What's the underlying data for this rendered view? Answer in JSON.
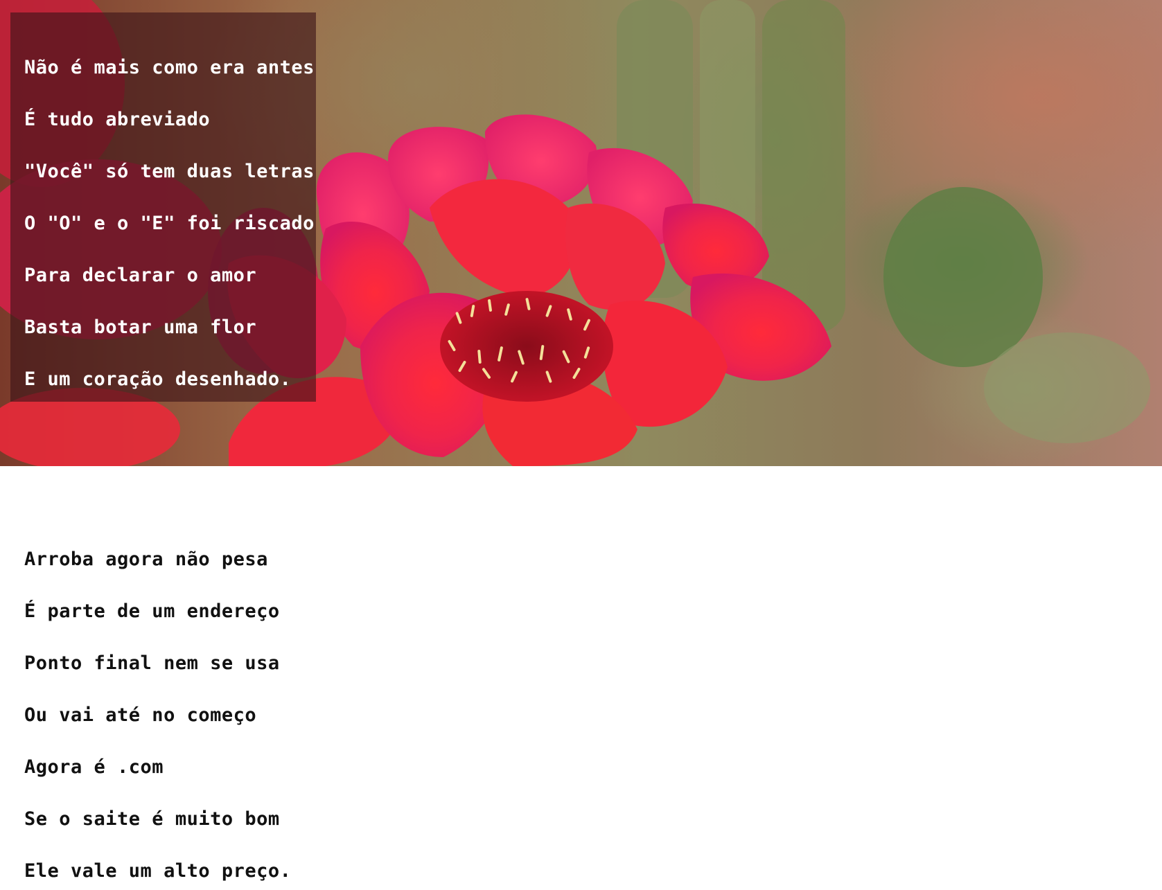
{
  "hero": {
    "image": "red-cactus-flower-photo",
    "caption_lines": [
      "Não é mais como era antes",
      "É tudo abreviado",
      "\"Você\" só tem duas letras",
      "O \"O\" e o \"E\" foi riscado",
      "Para declarar o amor",
      "Basta botar uma flor",
      "E um coração desenhado."
    ]
  },
  "poem": {
    "lines": [
      "Arroba agora não pesa",
      "É parte de um endereço",
      "Ponto final nem se usa",
      "Ou vai até no começo",
      "Agora é .com",
      "Se o saite é muito bom",
      "Ele vale um alto preço."
    ]
  },
  "colors": {
    "caption_text": "#ffffff",
    "caption_overlay": "#3c1419",
    "poem_text": "#111111",
    "flower": "#e8203f",
    "background": "#ffffff"
  }
}
